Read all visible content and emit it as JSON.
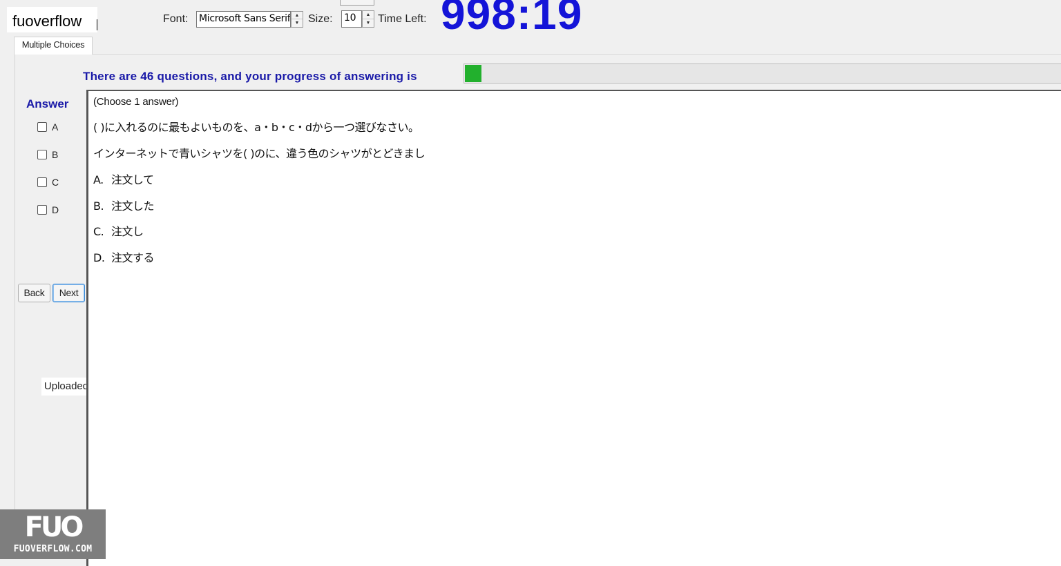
{
  "brand": {
    "name": "fuoverflow"
  },
  "toolbar": {
    "font_label": "Font:",
    "font_value": "Microsoft Sans Serif",
    "size_label": "Size:",
    "size_value": "10",
    "time_left_label": "Time Left:",
    "timer_value": "998:19"
  },
  "tabs": [
    {
      "label": "Multiple Choices",
      "active": true
    }
  ],
  "progress": {
    "text": "There are 46 questions, and your progress of answering is",
    "total_questions": 46,
    "fraction": 0.027,
    "fill_color": "#22b02d"
  },
  "answer_panel": {
    "title": "Answer",
    "options": [
      "A",
      "B",
      "C",
      "D"
    ],
    "back_label": "Back",
    "next_label": "Next",
    "status": "Uploaded"
  },
  "question": {
    "instruction": "(Choose 1 answer)",
    "prompt": "(                      )に入れるのに最もよいものを、a・b・c・dから一つ選びなさい。",
    "sentence": "インターネットで青いシャツを(                      )のに、違う色のシャツがとどきまし",
    "choices": [
      {
        "letter": "A.",
        "text": "注文して"
      },
      {
        "letter": "B.",
        "text": "注文した"
      },
      {
        "letter": "C.",
        "text": "注文し"
      },
      {
        "letter": "D.",
        "text": "注文する"
      }
    ]
  },
  "watermark": {
    "mark": "FUO",
    "sub": "FUOVERFLOW.COM"
  },
  "colors": {
    "accent": "#1a1aa8",
    "timer": "#1414d8"
  }
}
